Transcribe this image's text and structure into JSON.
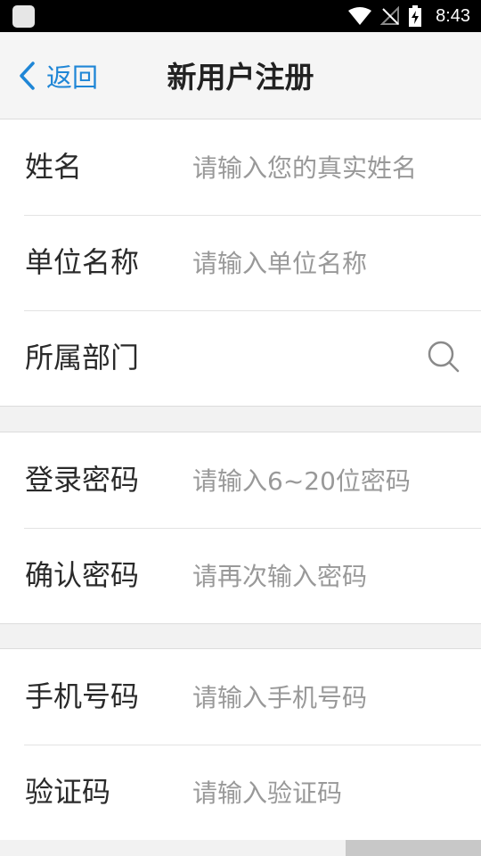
{
  "status_bar": {
    "time": "8:43",
    "icons": [
      "app-icon",
      "wifi-icon",
      "no-signal-icon",
      "battery-charging-icon"
    ]
  },
  "nav": {
    "back_label": "返回",
    "title": "新用户注册"
  },
  "groups": [
    {
      "rows": [
        {
          "label": "姓名",
          "placeholder": "请输入您的真实姓名"
        },
        {
          "label": "单位名称",
          "placeholder": "请输入单位名称"
        },
        {
          "label": "所属部门",
          "placeholder": "",
          "icon": "search-icon"
        }
      ]
    },
    {
      "rows": [
        {
          "label": "登录密码",
          "placeholder": "请输入6~20位密码"
        },
        {
          "label": "确认密码",
          "placeholder": "请再次输入密码"
        }
      ]
    },
    {
      "rows": [
        {
          "label": "手机号码",
          "placeholder": "请输入手机号码"
        },
        {
          "label": "验证码",
          "placeholder": "请输入验证码"
        }
      ]
    }
  ],
  "colors": {
    "accent": "#1f86d6",
    "background": "#f2f2f2",
    "placeholder": "#999999"
  }
}
